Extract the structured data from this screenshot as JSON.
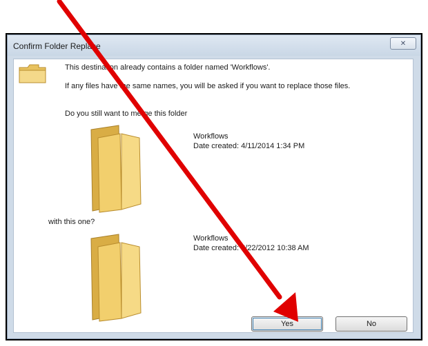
{
  "dialog": {
    "title": "Confirm Folder Replace",
    "close_label": "✕",
    "line1": "This destination already contains a folder named 'Workflows'.",
    "line2": "If any files have the same names, you will be asked if you want to replace those files.",
    "line3": "Do you still want to merge this folder",
    "source": {
      "name": "Workflows",
      "date": "Date created: 4/11/2014 1:34 PM"
    },
    "with_label": "with this one?",
    "destination": {
      "name": "Workflows",
      "date": "Date created: 8/22/2012 10:38 AM"
    },
    "yes_label": "Yes",
    "no_label": "No"
  },
  "colors": {
    "arrow": "#e00000",
    "folder_fill": "#f2d27a",
    "folder_dark": "#d9ad45"
  },
  "icons": {
    "header": "folder-icon",
    "source": "folder-icon",
    "destination": "folder-icon",
    "close": "close-icon"
  }
}
